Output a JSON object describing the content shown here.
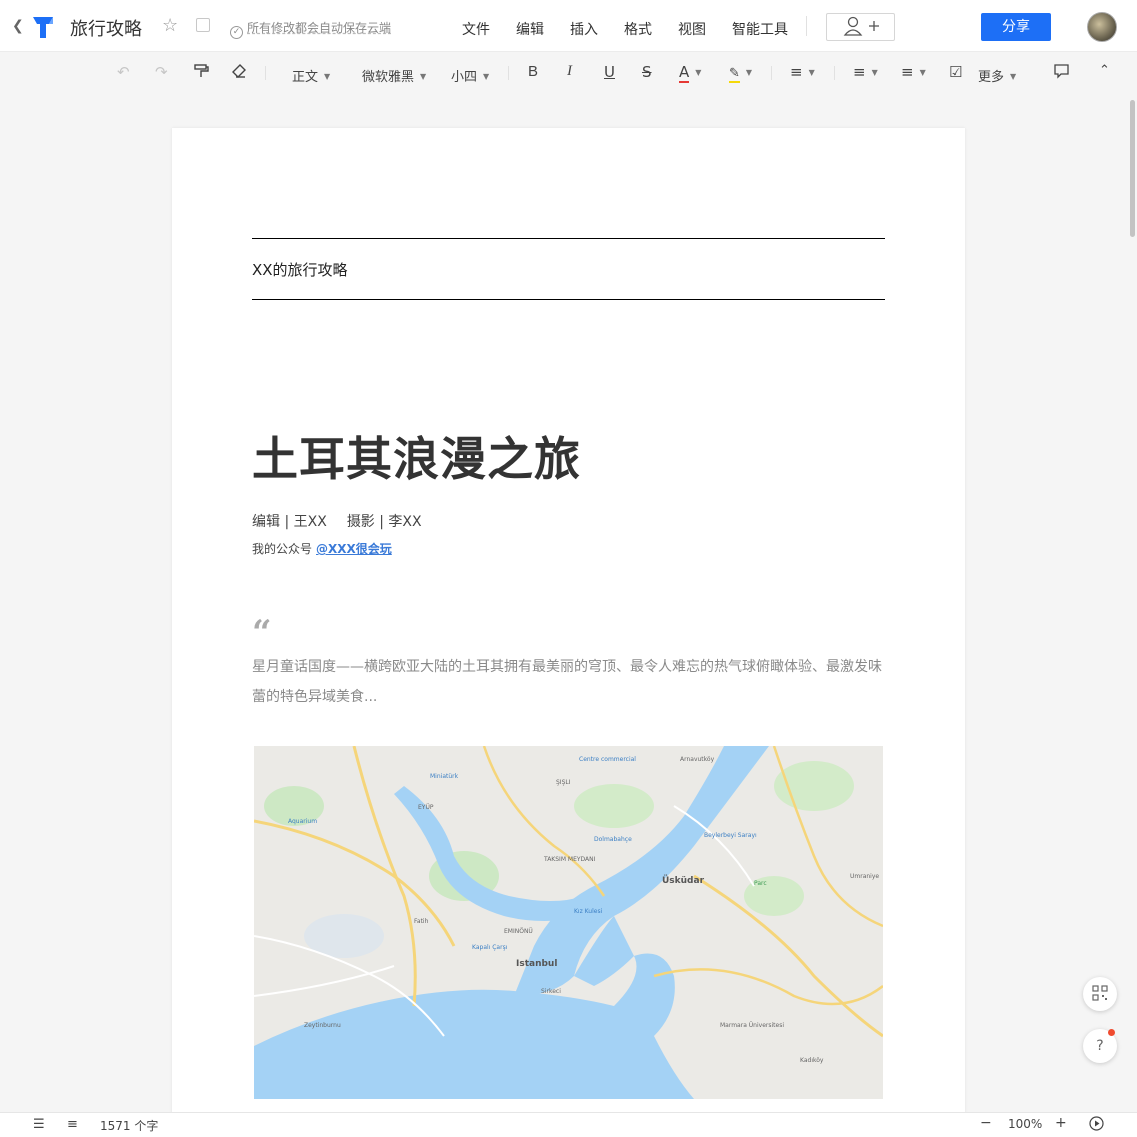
{
  "app": {
    "title": "旅行攻略",
    "save_status": "所有修改都会自动保存云端",
    "menus": [
      "文件",
      "编辑",
      "插入",
      "格式",
      "视图",
      "智能工具"
    ],
    "share_label": "分享",
    "brand_color": "#1d6ff6"
  },
  "toolbar": {
    "paragraph_style": "正文",
    "font_family": "微软雅黑",
    "font_size": "小四",
    "more_label": "更多"
  },
  "document": {
    "header": "XX的旅行攻略",
    "title": "土耳其浪漫之旅",
    "editor": "编辑 | 王XX",
    "photographer": "摄影 | 李XX",
    "account_prefix": "我的公众号",
    "account_link": "@XXX很会玩",
    "quote_mark": "“",
    "quote": "星月童话国度——横跨欧亚大陆的土耳其拥有最美丽的穹顶、最令人难忘的热气球俯瞰体验、最激发味蕾的特色异域美食..."
  },
  "map": {
    "labels": {
      "istanbul": "Istanbul",
      "uskudar": "Üsküdar",
      "sisli": "ŞIŞLI",
      "eminonu": "EMINÖNÜ",
      "sirkeci": "Sirkeci",
      "fatih": "Fatih",
      "eyup": "EYÜP",
      "zeytinburnu": "Zeytinburnu",
      "kadikoy": "Kadıköy",
      "umraniye": "Umraniye",
      "arnavutkoy": "Arnavutköy",
      "taksim": "TAKSIM MEYDANI",
      "dolmabahce": "Dolmabahçe",
      "centre_commercial": "Centre commercial",
      "kiz_kulesi": "Kız Kulesi",
      "beylerbeyi": "Beylerbeyi Sarayı",
      "aquarium": "Aquarium",
      "miniaturk": "Miniatürk",
      "kapali_carsi": "Kapalı Çarşı",
      "marmara": "Marmara Üniversitesi",
      "parc": "Parc"
    }
  },
  "status": {
    "word_count": "1571 个字",
    "zoom": "100%"
  }
}
